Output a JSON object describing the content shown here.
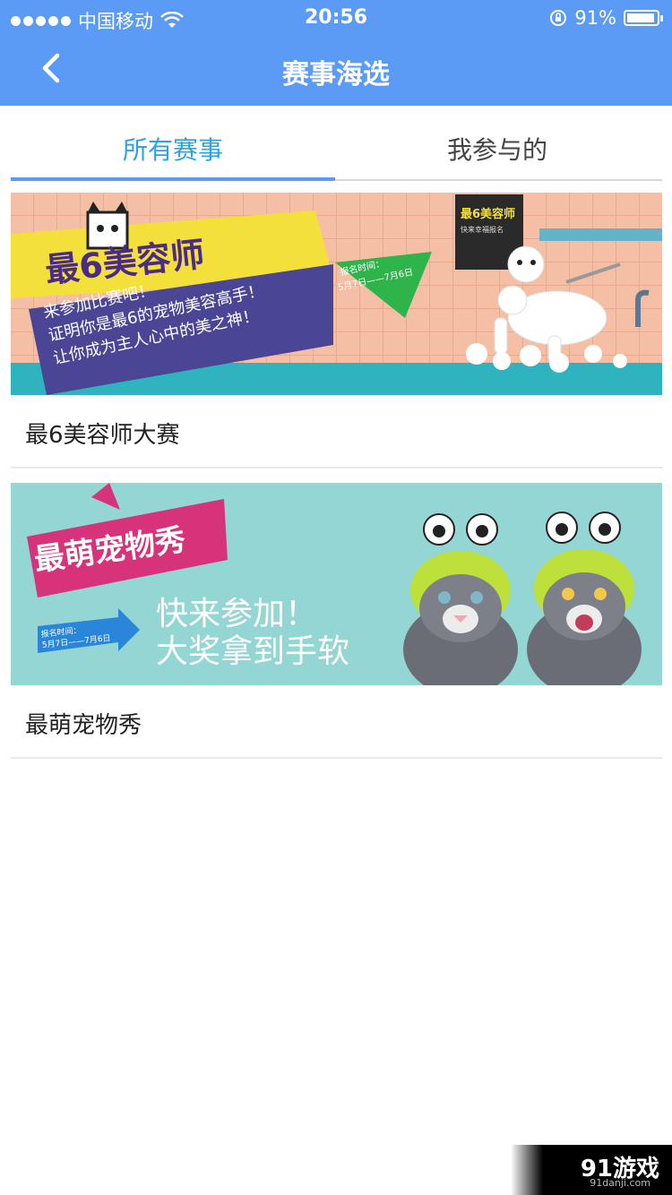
{
  "status_bar": {
    "carrier": "中国移动",
    "time": "20:56",
    "battery": "91%"
  },
  "nav": {
    "title": "赛事海选",
    "back_icon": "chevron-left-icon"
  },
  "tabs": [
    {
      "label": "所有赛事",
      "selected": true
    },
    {
      "label": "我参与的",
      "selected": false
    }
  ],
  "contests": [
    {
      "name": "最6美容师大赛",
      "banner": {
        "logo": "最6美容师",
        "slogan_lines": [
          "来参加比赛吧！",
          "证明你是最6的宠物美容高手！",
          "让你成为主人心中的美之神！"
        ],
        "tag_lines": [
          "报名时间：",
          "5月7日——7月6日"
        ],
        "board_title": "最6美容师",
        "board_sub": "快来幸福报名"
      }
    },
    {
      "name": "最萌宠物秀",
      "banner": {
        "logo": "最萌宠物秀",
        "slogan_lines": [
          "快来参加！",
          "大奖拿到手软"
        ],
        "tag_lines": [
          "报名时间：",
          "5月7日——7月6日"
        ]
      }
    }
  ],
  "watermark": {
    "text": "91游戏",
    "sub": "91danji.com"
  },
  "colors": {
    "header": "#5b9bf6",
    "tab_active": "#2aa4e0"
  }
}
